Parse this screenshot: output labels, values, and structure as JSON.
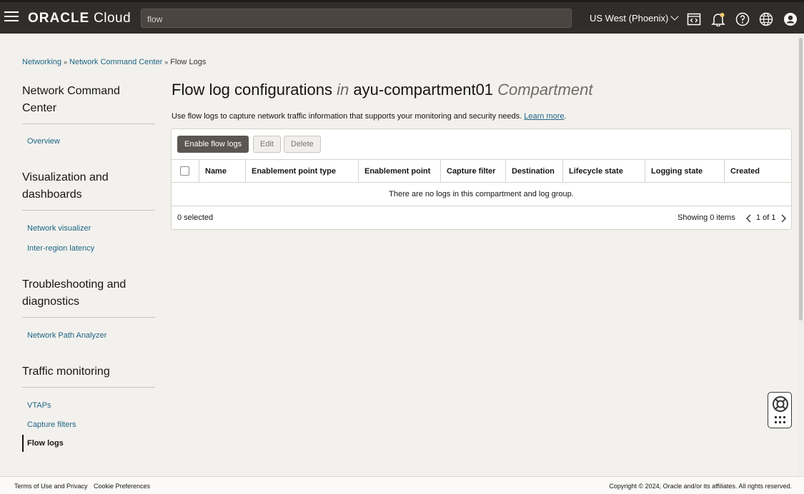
{
  "header": {
    "brand": "ORACLE",
    "product": "Cloud",
    "search_value": "flow",
    "region": "US West (Phoenix)",
    "icons": [
      "menu-icon",
      "code-editor-icon",
      "bell-icon",
      "help-icon",
      "globe-icon",
      "user-icon"
    ],
    "notification_dot_color": "#f0cc71"
  },
  "breadcrumb": {
    "items": [
      "Networking",
      "Network Command Center",
      "Flow Logs"
    ],
    "separator": "»"
  },
  "sidenav": {
    "sections": [
      {
        "heading": "Network Command Center",
        "items": [
          "Overview"
        ]
      },
      {
        "heading": "Visualization and dashboards",
        "items": [
          "Network visualizer",
          "Inter-region latency"
        ]
      },
      {
        "heading": "Troubleshooting and diagnostics",
        "items": [
          "Network Path Analyzer"
        ]
      },
      {
        "heading": "Traffic monitoring",
        "items": [
          "VTAPs",
          "Capture filters",
          "Flow logs"
        ]
      }
    ],
    "active_item": "Flow logs"
  },
  "main": {
    "title_main": "Flow log configurations",
    "title_in": "in",
    "compartment": "ayu-compartment01",
    "compartment_suffix": "Compartment",
    "description": "Use flow logs to capture network traffic information that supports your monitoring and security needs.",
    "learn_more": "Learn more",
    "buttons": {
      "enable": "Enable flow logs",
      "edit": "Edit",
      "delete": "Delete"
    },
    "table": {
      "columns": [
        "Name",
        "Enablement point type",
        "Enablement point",
        "Capture filter",
        "Destination",
        "Lifecycle state",
        "Logging state",
        "Created"
      ],
      "empty_message": "There are no logs in this compartment and log group."
    },
    "footer": {
      "selected": "0 selected",
      "showing": "Showing 0 items",
      "page": "1 of 1"
    }
  },
  "footer": {
    "terms": "Terms of Use and Privacy",
    "cookies": "Cookie Preferences",
    "copyright": "Copyright © 2024, Oracle and/or its affiliates. All rights reserved."
  },
  "colors": {
    "topbar": "#312d2a",
    "link": "#1d6585",
    "primary_button": "#5b5652",
    "page_background": "#f3f1ed"
  }
}
